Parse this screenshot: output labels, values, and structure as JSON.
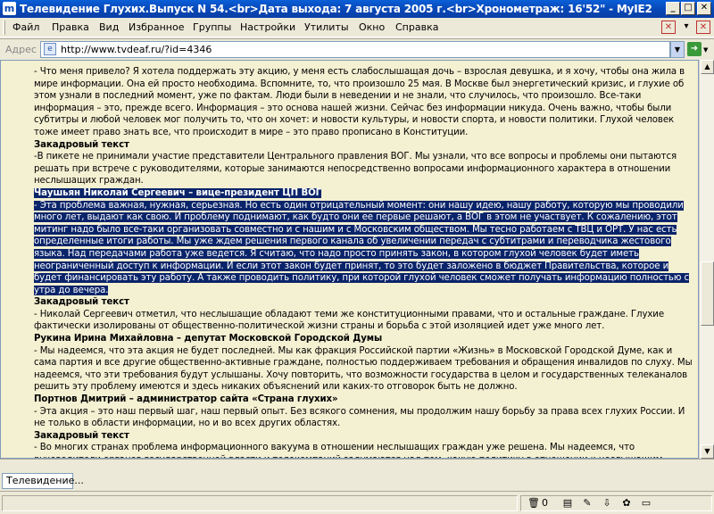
{
  "window": {
    "title": "Телевидение Глухих.Выпуск N 54.<br>Дата выхода: 7 августа 2005 г.<br>Хронометраж: 16'52\" - MyIE2",
    "app_icon_letter": "m"
  },
  "menu": [
    "Файл",
    "Правка",
    "Вид",
    "Избранное",
    "Группы",
    "Настройки",
    "Утилиты",
    "Окно",
    "Справка"
  ],
  "address": {
    "label": "Адрес",
    "url": "http://www.tvdeaf.ru/?id=4346"
  },
  "article": {
    "p1": "- Что меня привело? Я хотела поддержать эту акцию, у меня есть слабослышащая дочь – взрослая девушка, и я хочу, чтобы она жила в мире информации. Она ей просто необходима.  Вспомните, то, что произошло 25 мая. В Москве был энергетический кризис, и глухие об этом узнали в последний момент, уже по фактам. Люди были в неведении и не знали, что случилось, что произошло. Все-таки информация – это, прежде всего. Информация – это основа нашей жизни. Сейчас без информации никуда. Очень важно, чтобы были субтитры и любой человек мог получить то, что он хочет: и новости культуры, и новости спорта, и новости политики. Глухой человек тоже имеет право знать все, что происходит в мире – это право прописано в Конституции.",
    "h1": "Закадровый текст",
    "p2": "-В пикете не принимали участие представители Центрального правления ВОГ. Мы узнали, что все вопросы и проблемы они пытаются решать при встрече с руководителями, которые занимаются непосредственно вопросами информационного характера в отношении неслышащих граждан.",
    "h2": "Чаушьян Николай Сергеевич – вице-президент ЦП ВОГ",
    "p3": "- Эта проблема важная, нужная, серьезная. Но есть один отрицательный момент: они нашу идею, нашу работу, которую мы проводили много лет, выдают как свою. И проблему поднимают, как будто они ее первые решают, а ВОГ в этом не участвует. К сожалению, этот митинг надо было все-таки организовать совместно и с нашим и с Московским обществом. Мы тесно работаем с ТВЦ и ОРТ. У нас есть определенные итоги работы. Мы уже ждем решения первого канала об увеличении передач с субтитрами и переводчика жестового языка. Над передачами работа уже ведется. Я считаю, что надо просто принять закон, в котором глухой человек будет иметь неограниченный доступ к информации. И если этот закон будет принят, то это будет заложено в бюджет Правительства, которое и будет финансировать эту работу. А также проводить политику, при которой глухой человек сможет получать информацию полностью с утра до вечера.",
    "h3": "Закадровый текст",
    "p4": "- Николай Сергеевич отметил, что неслышащие обладают теми же конституционными правами, что и остальные граждане. Глухие фактически изолированы от общественно-политической жизни страны и борьба с этой изоляцией идет уже много лет.",
    "h4": "Рукина Ирина Михайловна – депутат Московской Городской Думы",
    "p5": "- Мы надеемся, что эта акция не будет последней. Мы как фракция Российской партии «Жизнь» в Московской  Городской Думе, как и сама партия и все другие общественно-активные граждане,  полностью поддерживаем требования и обращения инвалидов по слуху. Мы надеемся, что эти требования будут услышаны. Хочу повторить, что возможности государства в целом и государственных телеканалов решить эту проблему имеются и  здесь никаких объяснений или каких-то отговорок быть не должно.",
    "h5": "Портнов Дмитрий – администратор сайта «Страна глухих»",
    "p6": "- Эта акция – это наш первый шаг, наш первый опыт. Без всякого сомнения, мы продолжим нашу борьбу за права всех глухих России. И не только в области информации, но и во всех других областях.",
    "h6": "Закадровый текст",
    "p7": "- Во многих странах проблема информационного вакуума в отношении неслышащих граждан уже решена. Мы надеемся, что руководители органов государственной власти и телекомпаний задумаются над тем, какую политику в отношении к неслышащим гражданам."
  },
  "tabs": [
    "Телевидение..."
  ],
  "status": {
    "count": "0"
  },
  "colors": {
    "titlebar": "#0a46b3",
    "content_bg": "#f4f0d2",
    "selection": "#0a246a"
  },
  "icons": {
    "close": "close-icon",
    "go": "go-arrow-icon",
    "trash": "trash-icon"
  }
}
